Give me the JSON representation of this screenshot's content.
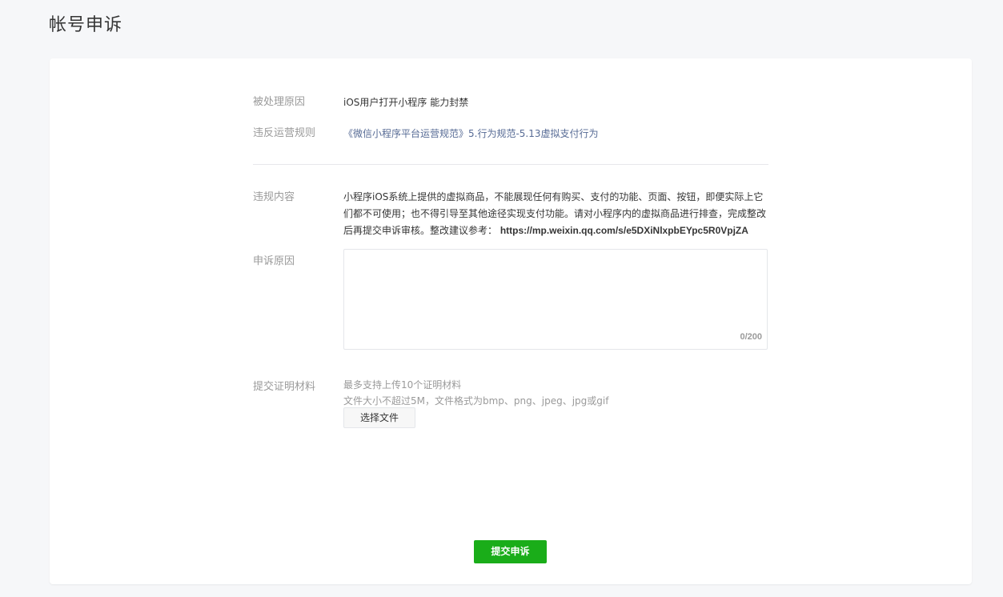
{
  "page": {
    "title": "帐号申诉"
  },
  "form": {
    "reason": {
      "label": "被处理原因",
      "value": "iOS用户打开小程序 能力封禁"
    },
    "rule": {
      "label": "违反运营规则",
      "value": "《微信小程序平台运营规范》5.行为规范-5.13虚拟支付行为"
    },
    "violation": {
      "label": "违规内容",
      "text": "小程序iOS系统上提供的虚拟商品，不能展现任何有购买、支付的功能、页面、按钮，即便实际上它们都不可使用；也不得引导至其他途径实现支付功能。请对小程序内的虚拟商品进行排查，完成整改后再提交申诉审核。整改建议参考：",
      "url": "https://mp.weixin.qq.com/s/e5DXiNlxpbEYpc5R0VpjZA"
    },
    "appeal": {
      "label": "申诉原因",
      "value": "",
      "counter": "0/200"
    },
    "evidence": {
      "label": "提交证明材料",
      "hint_count": "最多支持上传10个证明材料",
      "hint_format": "文件大小不超过5M，文件格式为bmp、png、jpeg、jpg或gif",
      "choose_file_label": "选择文件"
    },
    "submit_label": "提交申诉"
  },
  "colors": {
    "accent_green": "#1aad19",
    "link_blue": "#576b95",
    "label_gray": "#9a9a9a",
    "text_dark": "#353535"
  }
}
